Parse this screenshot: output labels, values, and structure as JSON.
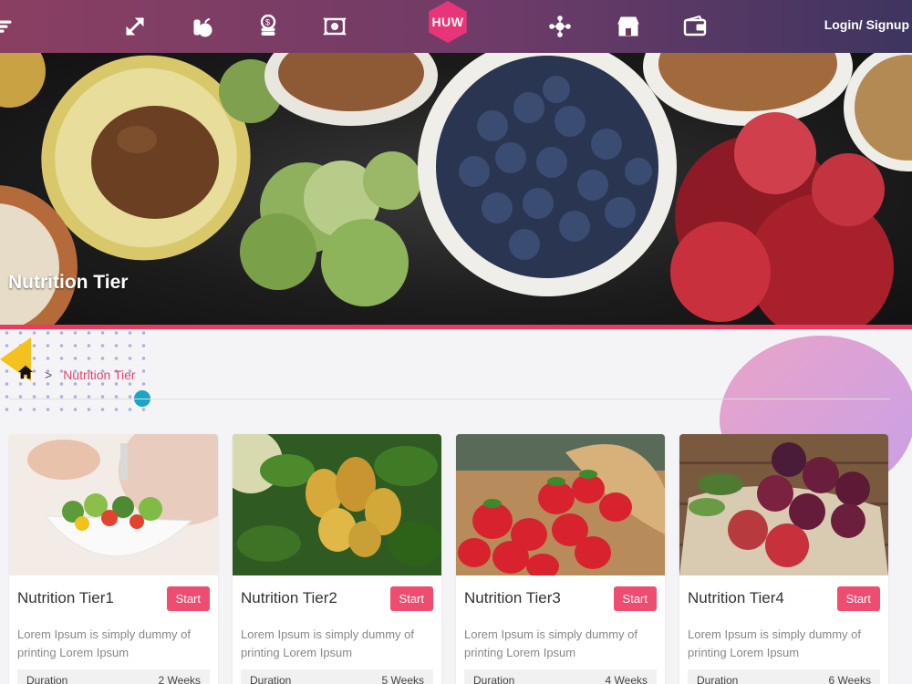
{
  "nav": {
    "logo_text": "HUW",
    "login_label": "Login/ Signup",
    "icons": [
      "menu-icon",
      "resize-arrows-icon",
      "fruit-icon",
      "coins-icon",
      "certificate-icon",
      "network-icon",
      "store-icon",
      "wallet-icon"
    ]
  },
  "hero": {
    "title": "Nutrition Tier"
  },
  "breadcrumb": {
    "separator": ">",
    "current": "Nutrition Tier"
  },
  "cards": [
    {
      "title": "Nutrition Tier1",
      "button": "Start",
      "description": "Lorem Ipsum is simply dummy of printing Lorem Ipsum",
      "duration_label": "Duration",
      "duration_value": "2 Weeks"
    },
    {
      "title": "Nutrition Tier2",
      "button": "Start",
      "description": "Lorem Ipsum is simply dummy of printing Lorem Ipsum",
      "duration_label": "Duration",
      "duration_value": "5 Weeks"
    },
    {
      "title": "Nutrition Tier3",
      "button": "Start",
      "description": "Lorem Ipsum is simply dummy of printing Lorem Ipsum",
      "duration_label": "Duration",
      "duration_value": "4 Weeks"
    },
    {
      "title": "Nutrition Tier4",
      "button": "Start",
      "description": "Lorem Ipsum is simply dummy of printing Lorem Ipsum",
      "duration_label": "Duration",
      "duration_value": "6 Weeks"
    }
  ],
  "colors": {
    "accent": "#e8436c",
    "nav_start": "#8a3f62",
    "nav_end": "#3e3560",
    "logo": "#e8357a"
  }
}
